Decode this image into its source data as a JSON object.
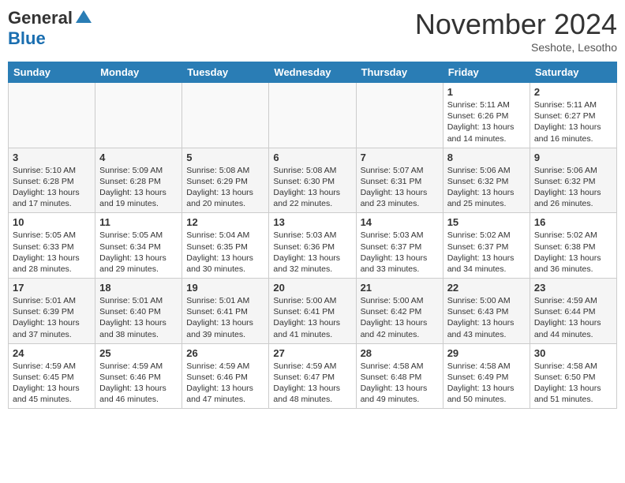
{
  "header": {
    "logo_general": "General",
    "logo_blue": "Blue",
    "month_title": "November 2024",
    "location": "Seshote, Lesotho"
  },
  "days_of_week": [
    "Sunday",
    "Monday",
    "Tuesday",
    "Wednesday",
    "Thursday",
    "Friday",
    "Saturday"
  ],
  "weeks": [
    [
      {
        "day": "",
        "info": ""
      },
      {
        "day": "",
        "info": ""
      },
      {
        "day": "",
        "info": ""
      },
      {
        "day": "",
        "info": ""
      },
      {
        "day": "",
        "info": ""
      },
      {
        "day": "1",
        "info": "Sunrise: 5:11 AM\nSunset: 6:26 PM\nDaylight: 13 hours\nand 14 minutes."
      },
      {
        "day": "2",
        "info": "Sunrise: 5:11 AM\nSunset: 6:27 PM\nDaylight: 13 hours\nand 16 minutes."
      }
    ],
    [
      {
        "day": "3",
        "info": "Sunrise: 5:10 AM\nSunset: 6:28 PM\nDaylight: 13 hours\nand 17 minutes."
      },
      {
        "day": "4",
        "info": "Sunrise: 5:09 AM\nSunset: 6:28 PM\nDaylight: 13 hours\nand 19 minutes."
      },
      {
        "day": "5",
        "info": "Sunrise: 5:08 AM\nSunset: 6:29 PM\nDaylight: 13 hours\nand 20 minutes."
      },
      {
        "day": "6",
        "info": "Sunrise: 5:08 AM\nSunset: 6:30 PM\nDaylight: 13 hours\nand 22 minutes."
      },
      {
        "day": "7",
        "info": "Sunrise: 5:07 AM\nSunset: 6:31 PM\nDaylight: 13 hours\nand 23 minutes."
      },
      {
        "day": "8",
        "info": "Sunrise: 5:06 AM\nSunset: 6:32 PM\nDaylight: 13 hours\nand 25 minutes."
      },
      {
        "day": "9",
        "info": "Sunrise: 5:06 AM\nSunset: 6:32 PM\nDaylight: 13 hours\nand 26 minutes."
      }
    ],
    [
      {
        "day": "10",
        "info": "Sunrise: 5:05 AM\nSunset: 6:33 PM\nDaylight: 13 hours\nand 28 minutes."
      },
      {
        "day": "11",
        "info": "Sunrise: 5:05 AM\nSunset: 6:34 PM\nDaylight: 13 hours\nand 29 minutes."
      },
      {
        "day": "12",
        "info": "Sunrise: 5:04 AM\nSunset: 6:35 PM\nDaylight: 13 hours\nand 30 minutes."
      },
      {
        "day": "13",
        "info": "Sunrise: 5:03 AM\nSunset: 6:36 PM\nDaylight: 13 hours\nand 32 minutes."
      },
      {
        "day": "14",
        "info": "Sunrise: 5:03 AM\nSunset: 6:37 PM\nDaylight: 13 hours\nand 33 minutes."
      },
      {
        "day": "15",
        "info": "Sunrise: 5:02 AM\nSunset: 6:37 PM\nDaylight: 13 hours\nand 34 minutes."
      },
      {
        "day": "16",
        "info": "Sunrise: 5:02 AM\nSunset: 6:38 PM\nDaylight: 13 hours\nand 36 minutes."
      }
    ],
    [
      {
        "day": "17",
        "info": "Sunrise: 5:01 AM\nSunset: 6:39 PM\nDaylight: 13 hours\nand 37 minutes."
      },
      {
        "day": "18",
        "info": "Sunrise: 5:01 AM\nSunset: 6:40 PM\nDaylight: 13 hours\nand 38 minutes."
      },
      {
        "day": "19",
        "info": "Sunrise: 5:01 AM\nSunset: 6:41 PM\nDaylight: 13 hours\nand 39 minutes."
      },
      {
        "day": "20",
        "info": "Sunrise: 5:00 AM\nSunset: 6:41 PM\nDaylight: 13 hours\nand 41 minutes."
      },
      {
        "day": "21",
        "info": "Sunrise: 5:00 AM\nSunset: 6:42 PM\nDaylight: 13 hours\nand 42 minutes."
      },
      {
        "day": "22",
        "info": "Sunrise: 5:00 AM\nSunset: 6:43 PM\nDaylight: 13 hours\nand 43 minutes."
      },
      {
        "day": "23",
        "info": "Sunrise: 4:59 AM\nSunset: 6:44 PM\nDaylight: 13 hours\nand 44 minutes."
      }
    ],
    [
      {
        "day": "24",
        "info": "Sunrise: 4:59 AM\nSunset: 6:45 PM\nDaylight: 13 hours\nand 45 minutes."
      },
      {
        "day": "25",
        "info": "Sunrise: 4:59 AM\nSunset: 6:46 PM\nDaylight: 13 hours\nand 46 minutes."
      },
      {
        "day": "26",
        "info": "Sunrise: 4:59 AM\nSunset: 6:46 PM\nDaylight: 13 hours\nand 47 minutes."
      },
      {
        "day": "27",
        "info": "Sunrise: 4:59 AM\nSunset: 6:47 PM\nDaylight: 13 hours\nand 48 minutes."
      },
      {
        "day": "28",
        "info": "Sunrise: 4:58 AM\nSunset: 6:48 PM\nDaylight: 13 hours\nand 49 minutes."
      },
      {
        "day": "29",
        "info": "Sunrise: 4:58 AM\nSunset: 6:49 PM\nDaylight: 13 hours\nand 50 minutes."
      },
      {
        "day": "30",
        "info": "Sunrise: 4:58 AM\nSunset: 6:50 PM\nDaylight: 13 hours\nand 51 minutes."
      }
    ]
  ]
}
